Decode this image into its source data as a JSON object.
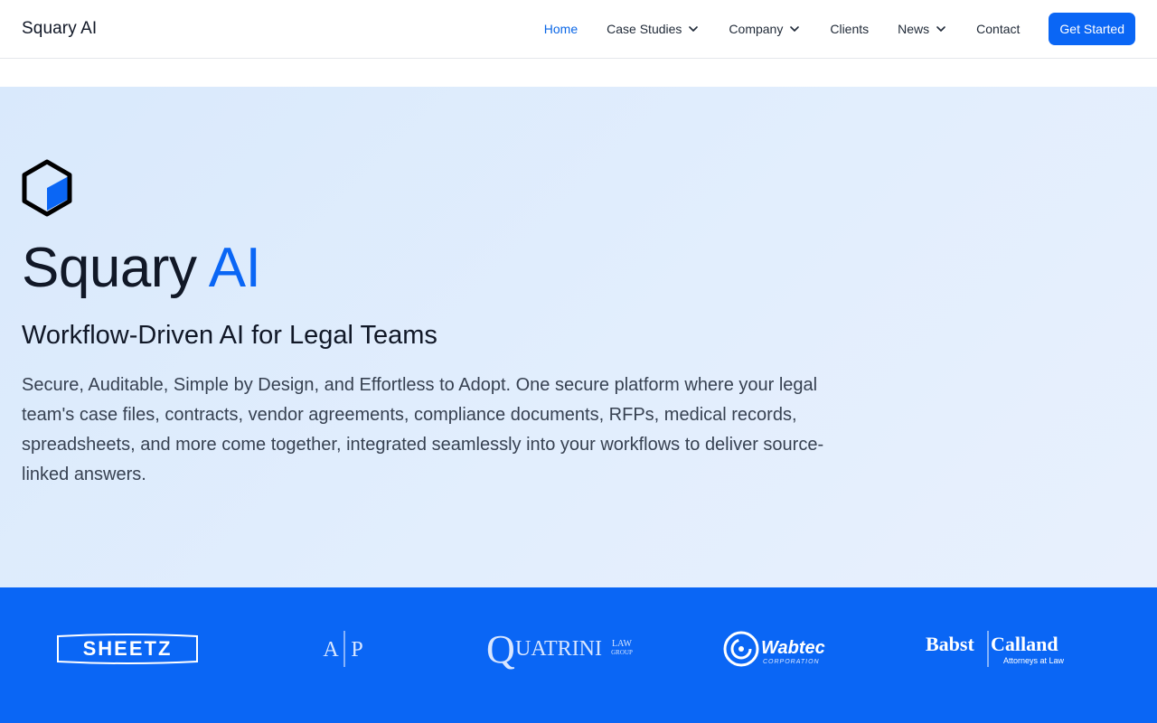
{
  "header": {
    "brand": "Squary AI",
    "nav": [
      {
        "label": "Home",
        "active": true,
        "has_dropdown": false
      },
      {
        "label": "Case Studies",
        "active": false,
        "has_dropdown": true
      },
      {
        "label": "Company",
        "active": false,
        "has_dropdown": true
      },
      {
        "label": "Clients",
        "active": false,
        "has_dropdown": false
      },
      {
        "label": "News",
        "active": false,
        "has_dropdown": true
      },
      {
        "label": "Contact",
        "active": false,
        "has_dropdown": false
      }
    ],
    "cta_label": "Get Started"
  },
  "hero": {
    "logo_icon": "hexagon-cube-icon",
    "title_main": "Squary",
    "title_accent": "AI",
    "subtitle": "Workflow-Driven AI for Legal Teams",
    "description": "Secure, Auditable, Simple by Design, and Effortless to Adopt. One secure platform where your legal team's case files, contracts, vendor agreements, compliance documents, RFPs, medical records, spreadsheets, and more come together, integrated seamlessly into your workflows to deliver source-linked answers."
  },
  "clients": [
    {
      "name": "SHEETZ"
    },
    {
      "name": "A|P",
      "left": "A",
      "right": "P"
    },
    {
      "name": "QUATRINI LAW GROUP",
      "big": "Q",
      "rest": "UATRINI",
      "tag1": "LAW",
      "tag2": "GROUP"
    },
    {
      "name": "Wabtec CORPORATION",
      "word": "Wabtec",
      "tag": "CORPORATION"
    },
    {
      "name": "Babst Calland Attorneys at Law",
      "left": "Babst",
      "right": "Calland",
      "tag": "Attorneys at Law"
    }
  ],
  "colors": {
    "accent": "#0a66f5",
    "band": "#0a66f5",
    "hero_bg": "#dce9fc"
  }
}
